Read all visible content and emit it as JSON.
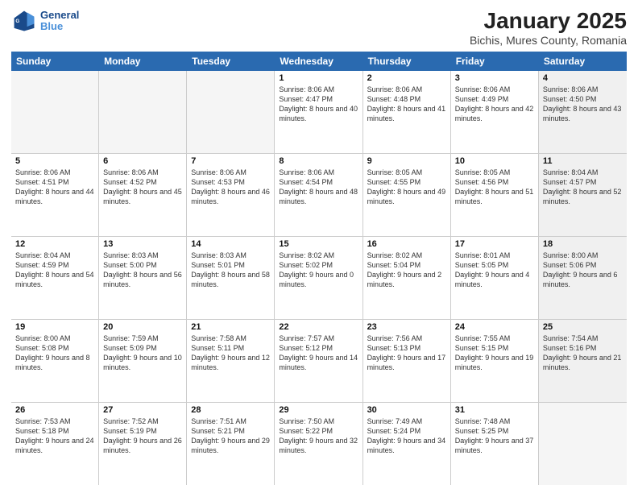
{
  "logo": {
    "line1": "General",
    "line2": "Blue"
  },
  "title": "January 2025",
  "subtitle": "Bichis, Mures County, Romania",
  "header_days": [
    "Sunday",
    "Monday",
    "Tuesday",
    "Wednesday",
    "Thursday",
    "Friday",
    "Saturday"
  ],
  "weeks": [
    [
      {
        "day": "",
        "sunrise": "",
        "sunset": "",
        "daylight": "",
        "shaded": true
      },
      {
        "day": "",
        "sunrise": "",
        "sunset": "",
        "daylight": "",
        "shaded": true
      },
      {
        "day": "",
        "sunrise": "",
        "sunset": "",
        "daylight": "",
        "shaded": true
      },
      {
        "day": "1",
        "sunrise": "Sunrise: 8:06 AM",
        "sunset": "Sunset: 4:47 PM",
        "daylight": "Daylight: 8 hours and 40 minutes."
      },
      {
        "day": "2",
        "sunrise": "Sunrise: 8:06 AM",
        "sunset": "Sunset: 4:48 PM",
        "daylight": "Daylight: 8 hours and 41 minutes."
      },
      {
        "day": "3",
        "sunrise": "Sunrise: 8:06 AM",
        "sunset": "Sunset: 4:49 PM",
        "daylight": "Daylight: 8 hours and 42 minutes."
      },
      {
        "day": "4",
        "sunrise": "Sunrise: 8:06 AM",
        "sunset": "Sunset: 4:50 PM",
        "daylight": "Daylight: 8 hours and 43 minutes.",
        "shaded": true
      }
    ],
    [
      {
        "day": "5",
        "sunrise": "Sunrise: 8:06 AM",
        "sunset": "Sunset: 4:51 PM",
        "daylight": "Daylight: 8 hours and 44 minutes."
      },
      {
        "day": "6",
        "sunrise": "Sunrise: 8:06 AM",
        "sunset": "Sunset: 4:52 PM",
        "daylight": "Daylight: 8 hours and 45 minutes."
      },
      {
        "day": "7",
        "sunrise": "Sunrise: 8:06 AM",
        "sunset": "Sunset: 4:53 PM",
        "daylight": "Daylight: 8 hours and 46 minutes."
      },
      {
        "day": "8",
        "sunrise": "Sunrise: 8:06 AM",
        "sunset": "Sunset: 4:54 PM",
        "daylight": "Daylight: 8 hours and 48 minutes."
      },
      {
        "day": "9",
        "sunrise": "Sunrise: 8:05 AM",
        "sunset": "Sunset: 4:55 PM",
        "daylight": "Daylight: 8 hours and 49 minutes."
      },
      {
        "day": "10",
        "sunrise": "Sunrise: 8:05 AM",
        "sunset": "Sunset: 4:56 PM",
        "daylight": "Daylight: 8 hours and 51 minutes."
      },
      {
        "day": "11",
        "sunrise": "Sunrise: 8:04 AM",
        "sunset": "Sunset: 4:57 PM",
        "daylight": "Daylight: 8 hours and 52 minutes.",
        "shaded": true
      }
    ],
    [
      {
        "day": "12",
        "sunrise": "Sunrise: 8:04 AM",
        "sunset": "Sunset: 4:59 PM",
        "daylight": "Daylight: 8 hours and 54 minutes."
      },
      {
        "day": "13",
        "sunrise": "Sunrise: 8:03 AM",
        "sunset": "Sunset: 5:00 PM",
        "daylight": "Daylight: 8 hours and 56 minutes."
      },
      {
        "day": "14",
        "sunrise": "Sunrise: 8:03 AM",
        "sunset": "Sunset: 5:01 PM",
        "daylight": "Daylight: 8 hours and 58 minutes."
      },
      {
        "day": "15",
        "sunrise": "Sunrise: 8:02 AM",
        "sunset": "Sunset: 5:02 PM",
        "daylight": "Daylight: 9 hours and 0 minutes."
      },
      {
        "day": "16",
        "sunrise": "Sunrise: 8:02 AM",
        "sunset": "Sunset: 5:04 PM",
        "daylight": "Daylight: 9 hours and 2 minutes."
      },
      {
        "day": "17",
        "sunrise": "Sunrise: 8:01 AM",
        "sunset": "Sunset: 5:05 PM",
        "daylight": "Daylight: 9 hours and 4 minutes."
      },
      {
        "day": "18",
        "sunrise": "Sunrise: 8:00 AM",
        "sunset": "Sunset: 5:06 PM",
        "daylight": "Daylight: 9 hours and 6 minutes.",
        "shaded": true
      }
    ],
    [
      {
        "day": "19",
        "sunrise": "Sunrise: 8:00 AM",
        "sunset": "Sunset: 5:08 PM",
        "daylight": "Daylight: 9 hours and 8 minutes."
      },
      {
        "day": "20",
        "sunrise": "Sunrise: 7:59 AM",
        "sunset": "Sunset: 5:09 PM",
        "daylight": "Daylight: 9 hours and 10 minutes."
      },
      {
        "day": "21",
        "sunrise": "Sunrise: 7:58 AM",
        "sunset": "Sunset: 5:11 PM",
        "daylight": "Daylight: 9 hours and 12 minutes."
      },
      {
        "day": "22",
        "sunrise": "Sunrise: 7:57 AM",
        "sunset": "Sunset: 5:12 PM",
        "daylight": "Daylight: 9 hours and 14 minutes."
      },
      {
        "day": "23",
        "sunrise": "Sunrise: 7:56 AM",
        "sunset": "Sunset: 5:13 PM",
        "daylight": "Daylight: 9 hours and 17 minutes."
      },
      {
        "day": "24",
        "sunrise": "Sunrise: 7:55 AM",
        "sunset": "Sunset: 5:15 PM",
        "daylight": "Daylight: 9 hours and 19 minutes."
      },
      {
        "day": "25",
        "sunrise": "Sunrise: 7:54 AM",
        "sunset": "Sunset: 5:16 PM",
        "daylight": "Daylight: 9 hours and 21 minutes.",
        "shaded": true
      }
    ],
    [
      {
        "day": "26",
        "sunrise": "Sunrise: 7:53 AM",
        "sunset": "Sunset: 5:18 PM",
        "daylight": "Daylight: 9 hours and 24 minutes."
      },
      {
        "day": "27",
        "sunrise": "Sunrise: 7:52 AM",
        "sunset": "Sunset: 5:19 PM",
        "daylight": "Daylight: 9 hours and 26 minutes."
      },
      {
        "day": "28",
        "sunrise": "Sunrise: 7:51 AM",
        "sunset": "Sunset: 5:21 PM",
        "daylight": "Daylight: 9 hours and 29 minutes."
      },
      {
        "day": "29",
        "sunrise": "Sunrise: 7:50 AM",
        "sunset": "Sunset: 5:22 PM",
        "daylight": "Daylight: 9 hours and 32 minutes."
      },
      {
        "day": "30",
        "sunrise": "Sunrise: 7:49 AM",
        "sunset": "Sunset: 5:24 PM",
        "daylight": "Daylight: 9 hours and 34 minutes."
      },
      {
        "day": "31",
        "sunrise": "Sunrise: 7:48 AM",
        "sunset": "Sunset: 5:25 PM",
        "daylight": "Daylight: 9 hours and 37 minutes."
      },
      {
        "day": "",
        "sunrise": "",
        "sunset": "",
        "daylight": "",
        "shaded": true
      }
    ]
  ]
}
